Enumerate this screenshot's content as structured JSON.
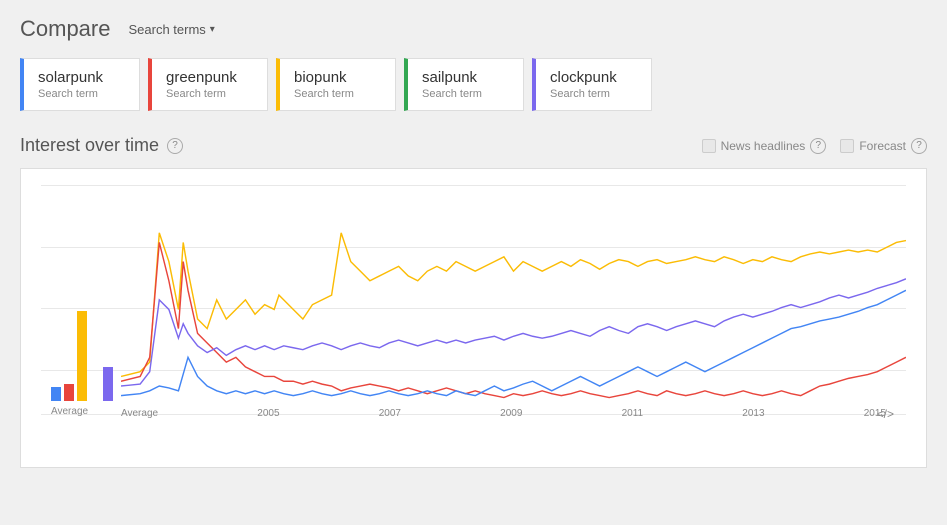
{
  "header": {
    "title": "Compare",
    "searchTermsLabel": "Search terms",
    "dropdownArrow": "▾"
  },
  "terms": [
    {
      "id": "solarpunk",
      "name": "solarpunk",
      "type": "Search term",
      "color": "#4285f4"
    },
    {
      "id": "greenpunk",
      "name": "greenpunk",
      "type": "Search term",
      "color": "#e8453c"
    },
    {
      "id": "biopunk",
      "name": "biopunk",
      "type": "Search term",
      "color": "#fbbc05"
    },
    {
      "id": "sailpunk",
      "name": "sailpunk",
      "type": "Search term",
      "color": "#34a853"
    },
    {
      "id": "clockpunk",
      "name": "clockpunk",
      "type": "Search term",
      "color": "#7b68ee"
    }
  ],
  "chart": {
    "sectionTitle": "Interest over time",
    "helpLabel": "?",
    "legend": [
      {
        "id": "news-headlines",
        "label": "News headlines",
        "helpLabel": "?"
      },
      {
        "id": "forecast",
        "label": "Forecast",
        "helpLabel": "?"
      }
    ],
    "xLabels": [
      "Average",
      "2005",
      "2007",
      "2009",
      "2011",
      "2013",
      "2015"
    ],
    "embedLabel": "</>",
    "avgBars": [
      {
        "color": "#4285f4",
        "heightPct": 12
      },
      {
        "color": "#e8453c",
        "heightPct": 14
      },
      {
        "color": "#fbbc05",
        "heightPct": 75
      },
      {
        "color": "#34a853",
        "heightPct": 0
      },
      {
        "color": "#7b68ee",
        "heightPct": 28
      }
    ]
  }
}
